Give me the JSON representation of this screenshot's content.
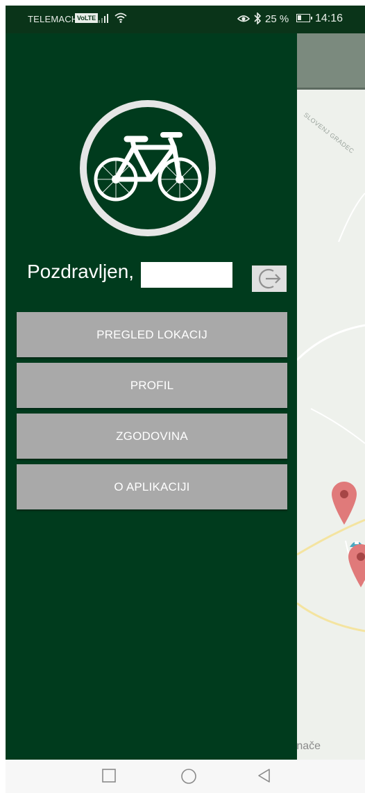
{
  "status_bar": {
    "carrier": "TELEMACH",
    "volte": "VoLTE",
    "battery_percent": "25 %",
    "time": "14:16",
    "icons": [
      "signal-icon",
      "wifi-icon",
      "eye-icon",
      "bluetooth-icon",
      "battery-icon"
    ]
  },
  "drawer": {
    "logo_icon": "bicycle-icon",
    "greeting": "Pozdravljen,",
    "logout_icon": "logout-icon",
    "menu": [
      {
        "label": "PREGLED LOKACIJ"
      },
      {
        "label": "PROFIL"
      },
      {
        "label": "ZGODOVINA"
      },
      {
        "label": "O APLIKACIJI"
      }
    ]
  },
  "map": {
    "place_label": "SLOVENJ GRADEC",
    "bottom_label": "rnače"
  },
  "nav_bar": {
    "icons": [
      "recent-apps-icon",
      "home-icon",
      "back-icon"
    ]
  },
  "colors": {
    "drawer_bg": "#003b1d",
    "status_bar_bg": "#0a3419",
    "menu_button_bg": "#a9a9a9",
    "pin": "#e07a7a"
  }
}
